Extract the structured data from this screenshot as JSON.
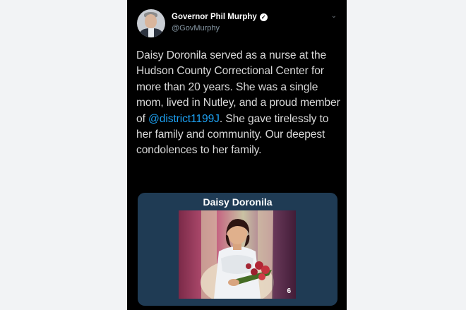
{
  "tweet": {
    "author_name": "Governor Phil Murphy",
    "author_handle": "@GovMurphy",
    "text_before": "Daisy Doronila served as a nurse at the Hudson County Correctional Center for more than 20 years. She was a single mom, lived in Nutley, and a proud member of ",
    "mention": "@district1199J",
    "text_after": ". She gave tirelessly to her family and community. Our deepest condolences to her family.",
    "icons": {
      "verified": "verified-badge-icon",
      "menu": "chevron-down-icon"
    }
  },
  "media": {
    "title": "Daisy Doronila",
    "page_number": "6"
  },
  "colors": {
    "background": "#000000",
    "text": "#d9d9d9",
    "mention": "#1da1f2",
    "media_panel": "#1f3b54"
  }
}
